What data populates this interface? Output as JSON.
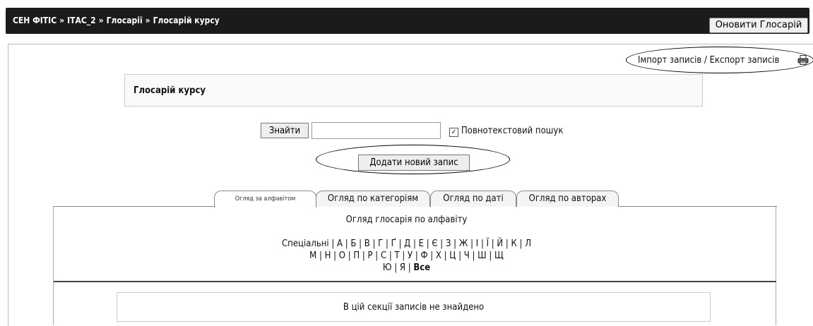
{
  "breadcrumb": {
    "items": [
      "СЕН ФІТІС",
      "ІТАС_2",
      "Глосарії",
      "Глосарій курсу"
    ],
    "separator": "»"
  },
  "header": {
    "update_button": "Оновити Глосарій"
  },
  "links": {
    "import_export": "Імпорт записів / Експорт записів"
  },
  "glossary": {
    "title": "Глосарій курсу"
  },
  "search": {
    "button": "Знайти",
    "value": "",
    "fulltext_label": "Повнотекстовий пошук",
    "fulltext_checked": "✓"
  },
  "add_entry": "Додати новий запис",
  "tabs": [
    {
      "label": "Огляд за алфавітом",
      "active": true
    },
    {
      "label": "Огляд по категоріям"
    },
    {
      "label": "Огляд по даті"
    },
    {
      "label": "Огляд по авторах"
    }
  ],
  "browse": {
    "title": "Огляд глосарія по алфавіту",
    "line1": "Спеціальні | А | Б | В | Г | Ґ | Д | Е | Є | З | Ж | І | Ї | Й | К | Л",
    "line2": "М | Н | О | П | Р | С | Т | У | Ф | Х | Ц | Ч | Ш | Щ",
    "line3_prefix": "Ю | Я | ",
    "line3_all": "Все"
  },
  "empty_message": "В цій секції записів не знайдено"
}
